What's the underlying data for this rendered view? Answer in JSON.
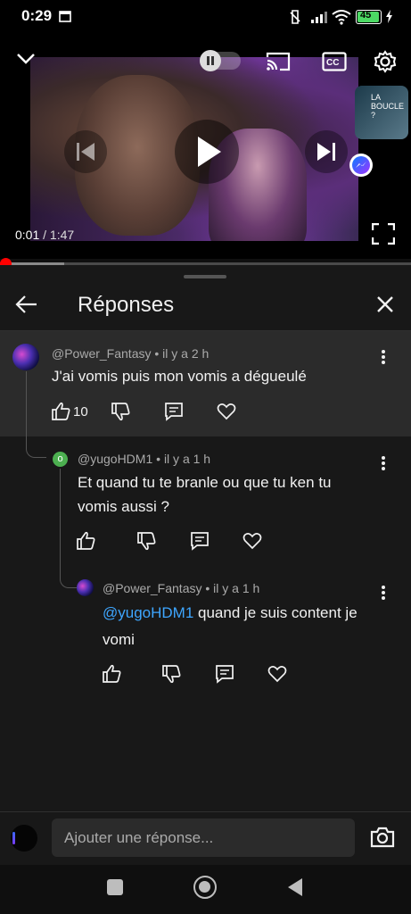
{
  "status_bar": {
    "time": "0:29",
    "battery": "45"
  },
  "player": {
    "current_time": "0:01",
    "duration": "1:47",
    "progress_fraction": 0.01,
    "side_video_label": "LA BOUCLE ?"
  },
  "panel": {
    "title": "Réponses"
  },
  "comments": [
    {
      "author": "@Power_Fantasy",
      "time": "il y a 2 h",
      "text": "J'ai vomis puis mon vomis a dégueulé",
      "likes": "10"
    },
    {
      "author": "@yugoHDM1",
      "time": "il y a 1 h",
      "avatar_letter": "o",
      "text_line1": "Et quand tu te branle ou que tu ken tu",
      "text_line2": "vomis aussi ?"
    },
    {
      "author": "@Power_Fantasy",
      "time": "il y a 1 h",
      "mention": "@yugoHDM1",
      "text_line1": " quand je suis content je",
      "text_line2": "vomi"
    }
  ],
  "reply_box": {
    "placeholder": "Ajouter une réponse..."
  },
  "colors": {
    "accent_red": "#ff0000",
    "mention_blue": "#3ea6ff",
    "avatar_green": "#4caf50"
  }
}
